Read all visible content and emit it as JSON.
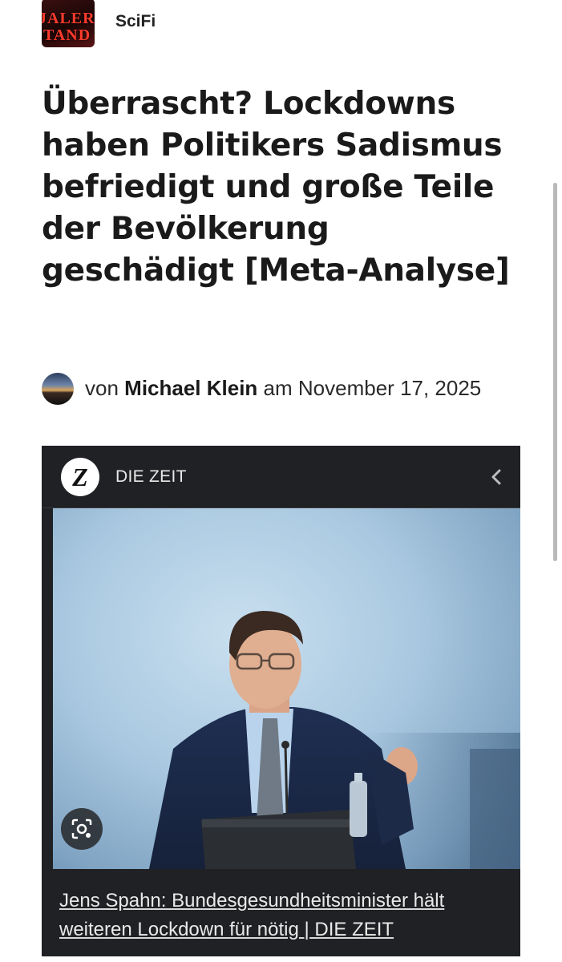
{
  "site": {
    "logo_text_line1": "JALER",
    "logo_text_line2": "TAND",
    "name": "SciFi"
  },
  "article": {
    "title": "Überrascht? Lockdowns haben Politikers Sadismus befriedigt und große Teile der Bevölkerung geschädigt [Meta-Analyse]",
    "byline_prefix": "von",
    "author": "Michael Klein",
    "byline_mid": "am",
    "date": "November 17, 2025"
  },
  "embed": {
    "source_logo_letter": "Z",
    "source_name": "DIE ZEIT",
    "caption": "Jens Spahn: Bundesgesundheitsminister hält weiteren Lockdown für nötig | DIE ZEIT",
    "icons": {
      "back": "chevron-left-icon",
      "lens": "visual-search-icon"
    }
  },
  "colors": {
    "embed_background": "#202124",
    "title_text": "#1a1a1a",
    "logo_red": "#ff3b2b"
  }
}
